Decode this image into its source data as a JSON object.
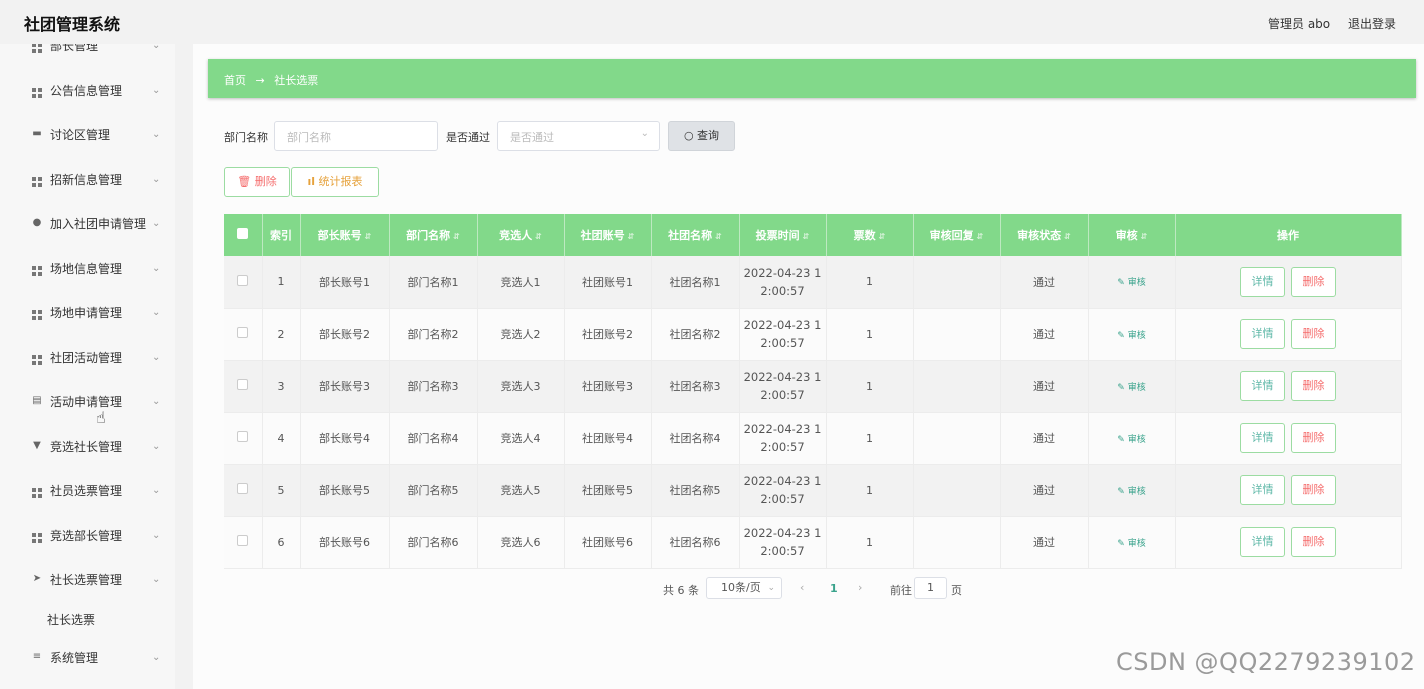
{
  "header": {
    "title": "社团管理系统",
    "user": "管理员 abo",
    "logout": "退出登录"
  },
  "sidebar": {
    "items": [
      {
        "label": "部长管理",
        "icon": "grid-icon"
      },
      {
        "label": "公告信息管理",
        "icon": "grid-icon"
      },
      {
        "label": "讨论区管理",
        "icon": "monitor-icon"
      },
      {
        "label": "招新信息管理",
        "icon": "grid-icon"
      },
      {
        "label": "加入社团申请管理",
        "icon": "location-icon"
      },
      {
        "label": "场地信息管理",
        "icon": "grid-icon"
      },
      {
        "label": "场地申请管理",
        "icon": "grid-icon"
      },
      {
        "label": "社团活动管理",
        "icon": "grid-icon"
      },
      {
        "label": "活动申请管理",
        "icon": "clipboard-icon"
      },
      {
        "label": "竞选社长管理",
        "icon": "trophy-icon"
      },
      {
        "label": "社员选票管理",
        "icon": "grid-icon"
      },
      {
        "label": "竞选部长管理",
        "icon": "grid-icon"
      },
      {
        "label": "社长选票管理",
        "icon": "send-icon"
      },
      {
        "label": "系统管理",
        "icon": "menu-icon"
      }
    ],
    "sub_item": "社长选票"
  },
  "breadcrumb": {
    "home": "首页",
    "arrow": "→",
    "current": "社长选票"
  },
  "search": {
    "dept_label": "部门名称",
    "dept_placeholder": "部门名称",
    "pass_label": "是否通过",
    "pass_placeholder": "是否通过",
    "query_button": "查询"
  },
  "actions": {
    "delete": "删除",
    "stats": "统计报表"
  },
  "table": {
    "headers": [
      "索引",
      "部长账号",
      "部门名称",
      "竞选人",
      "社团账号",
      "社团名称",
      "投票时间",
      "票数",
      "审核回复",
      "审核状态",
      "审核",
      "操作"
    ],
    "rows": [
      {
        "idx": "1",
        "account": "部长账号1",
        "dept": "部门名称1",
        "candidate": "竞选人1",
        "club_account": "社团账号1",
        "club_name": "社团名称1",
        "time1": "2022-04-23 1",
        "time2": "2:00:57",
        "votes": "1",
        "reply": "",
        "status": "通过"
      },
      {
        "idx": "2",
        "account": "部长账号2",
        "dept": "部门名称2",
        "candidate": "竞选人2",
        "club_account": "社团账号2",
        "club_name": "社团名称2",
        "time1": "2022-04-23 1",
        "time2": "2:00:57",
        "votes": "1",
        "reply": "",
        "status": "通过"
      },
      {
        "idx": "3",
        "account": "部长账号3",
        "dept": "部门名称3",
        "candidate": "竞选人3",
        "club_account": "社团账号3",
        "club_name": "社团名称3",
        "time1": "2022-04-23 1",
        "time2": "2:00:57",
        "votes": "1",
        "reply": "",
        "status": "通过"
      },
      {
        "idx": "4",
        "account": "部长账号4",
        "dept": "部门名称4",
        "candidate": "竞选人4",
        "club_account": "社团账号4",
        "club_name": "社团名称4",
        "time1": "2022-04-23 1",
        "time2": "2:00:57",
        "votes": "1",
        "reply": "",
        "status": "通过"
      },
      {
        "idx": "5",
        "account": "部长账号5",
        "dept": "部门名称5",
        "candidate": "竞选人5",
        "club_account": "社团账号5",
        "club_name": "社团名称5",
        "time1": "2022-04-23 1",
        "time2": "2:00:57",
        "votes": "1",
        "reply": "",
        "status": "通过"
      },
      {
        "idx": "6",
        "account": "部长账号6",
        "dept": "部门名称6",
        "candidate": "竞选人6",
        "club_account": "社团账号6",
        "club_name": "社团名称6",
        "time1": "2022-04-23 1",
        "time2": "2:00:57",
        "votes": "1",
        "reply": "",
        "status": "通过"
      }
    ],
    "audit_label": "审核",
    "detail_label": "详情",
    "row_delete_label": "删除"
  },
  "pagination": {
    "total": "共 6 条",
    "page_size": "10条/页",
    "current": "1",
    "goto_label": "前往",
    "goto_value": "1",
    "page_suffix": "页"
  },
  "watermark": "CSDN @QQ2279239102",
  "colors": {
    "accent": "#82d98a",
    "danger": "#f56c6c",
    "warning": "#e6a23c",
    "link": "#3aa38c"
  }
}
